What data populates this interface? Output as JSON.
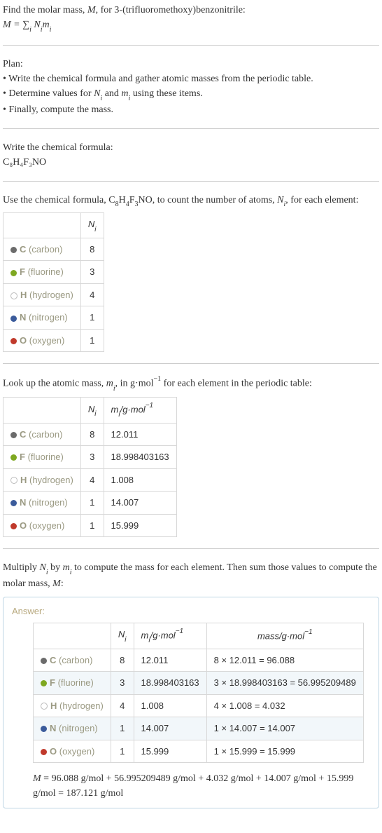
{
  "intro": {
    "line1_a": "Find the molar mass, ",
    "line1_b": "M",
    "line1_c": ", for 3-(trifluoromethoxy)benzonitrile:",
    "eq_left": "M",
    "eq_sum": " = ∑",
    "eq_sub": "i",
    "eq_right": " N",
    "eq_sub2": "i",
    "eq_right2": "m",
    "eq_sub3": "i"
  },
  "plan": {
    "header": "Plan:",
    "b1": "• Write the chemical formula and gather atomic masses from the periodic table.",
    "b2_a": "• Determine values for ",
    "b2_ni": "N",
    "b2_nis": "i",
    "b2_mid": " and ",
    "b2_mi": "m",
    "b2_mis": "i",
    "b2_end": " using these items.",
    "b3": "• Finally, compute the mass."
  },
  "formula": {
    "header": "Write the chemical formula:",
    "text": "C₈H₄F₃NO"
  },
  "count": {
    "header_a": "Use the chemical formula, C",
    "header_b": "8",
    "header_c": "H",
    "header_d": "4",
    "header_e": "F",
    "header_f": "3",
    "header_g": "NO, to count the number of atoms, ",
    "header_ni": "N",
    "header_nis": "i",
    "header_end": ", for each element:",
    "col_ni": "N",
    "col_nis": "i",
    "rows": {
      "c": {
        "sym": "C",
        "name": " (carbon)",
        "n": "8"
      },
      "f": {
        "sym": "F",
        "name": " (fluorine)",
        "n": "3"
      },
      "h": {
        "sym": "H",
        "name": " (hydrogen)",
        "n": "4"
      },
      "nn": {
        "sym": "N",
        "name": " (nitrogen)",
        "n": "1"
      },
      "o": {
        "sym": "O",
        "name": " (oxygen)",
        "n": "1"
      }
    }
  },
  "masses": {
    "header_a": "Look up the atomic mass, ",
    "header_mi": "m",
    "header_mis": "i",
    "header_b": ", in g·mol",
    "header_exp": "−1",
    "header_end": " for each element in the periodic table:",
    "col_ni": "N",
    "col_nis": "i",
    "col_mi": "m",
    "col_mis": "i",
    "col_unit": "/g·mol",
    "col_exp": "−1",
    "rows": {
      "c": {
        "sym": "C",
        "name": " (carbon)",
        "n": "8",
        "m": "12.011"
      },
      "f": {
        "sym": "F",
        "name": " (fluorine)",
        "n": "3",
        "m": "18.998403163"
      },
      "h": {
        "sym": "H",
        "name": " (hydrogen)",
        "n": "4",
        "m": "1.008"
      },
      "nn": {
        "sym": "N",
        "name": " (nitrogen)",
        "n": "1",
        "m": "14.007"
      },
      "o": {
        "sym": "O",
        "name": " (oxygen)",
        "n": "1",
        "m": "15.999"
      }
    }
  },
  "multiply": {
    "text_a": "Multiply ",
    "ni": "N",
    "nis": "i",
    "text_b": " by ",
    "mi": "m",
    "mis": "i",
    "text_c": " to compute the mass for each element. Then sum those values to compute the molar mass, ",
    "Mvar": "M",
    "text_d": ":"
  },
  "answer": {
    "label": "Answer:",
    "col_ni": "N",
    "col_nis": "i",
    "col_mi": "m",
    "col_mis": "i",
    "col_unit": "/g·mol",
    "col_exp": "−1",
    "col_mass": "mass/g·mol",
    "col_mass_exp": "−1",
    "rows": {
      "c": {
        "sym": "C",
        "name": " (carbon)",
        "n": "8",
        "m": "12.011",
        "calc": "8 × 12.011 = 96.088"
      },
      "f": {
        "sym": "F",
        "name": " (fluorine)",
        "n": "3",
        "m": "18.998403163",
        "calc": "3 × 18.998403163 = 56.995209489"
      },
      "h": {
        "sym": "H",
        "name": " (hydrogen)",
        "n": "4",
        "m": "1.008",
        "calc": "4 × 1.008 = 4.032"
      },
      "nn": {
        "sym": "N",
        "name": " (nitrogen)",
        "n": "1",
        "m": "14.007",
        "calc": "1 × 14.007 = 14.007"
      },
      "o": {
        "sym": "O",
        "name": " (oxygen)",
        "n": "1",
        "m": "15.999",
        "calc": "1 × 15.999 = 15.999"
      }
    },
    "final_a": "M",
    "final_b": " = 96.088 g/mol + 56.995209489 g/mol + 4.032 g/mol + 14.007 g/mol + 15.999 g/mol = 187.121 g/mol"
  }
}
